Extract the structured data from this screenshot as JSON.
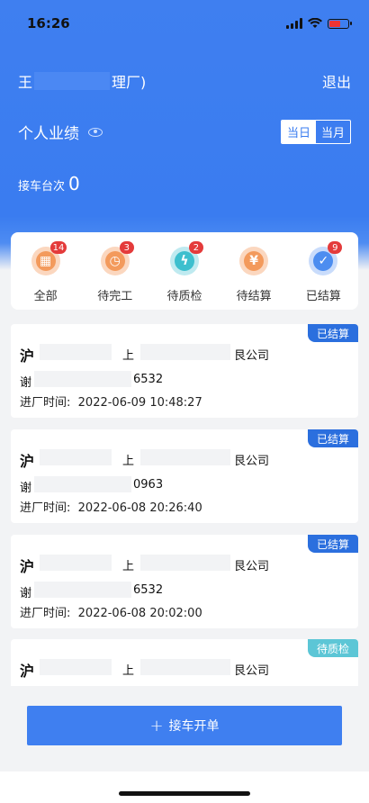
{
  "status": {
    "time": "16:26"
  },
  "header": {
    "user_prefix": "王",
    "user_suffix": "理厂)",
    "logout": "退出",
    "perf_title": "个人业绩",
    "toggle_day": "当日",
    "toggle_month": "当月",
    "count_label": "接车台次",
    "count_value": "0"
  },
  "categories": [
    {
      "label": "全部",
      "badge": "14",
      "color": "#f39a5c",
      "glyph": "▦"
    },
    {
      "label": "待完工",
      "badge": "3",
      "color": "#f39a5c",
      "glyph": "◷"
    },
    {
      "label": "待质检",
      "badge": "2",
      "color": "#3dbfce",
      "glyph": "ϟ"
    },
    {
      "label": "待结算",
      "badge": "",
      "color": "#f39a5c",
      "glyph": "¥"
    },
    {
      "label": "已结算",
      "badge": "9",
      "color": "#4c8df0",
      "glyph": "✓"
    }
  ],
  "cards": [
    {
      "status": "已结算",
      "plate": "沪",
      "company_prefix": "上",
      "company_suffix": "艮公司",
      "owner": "谢",
      "phone_suffix": "6532",
      "time_label": "进厂时间:",
      "time": "2022-06-09 10:48:27"
    },
    {
      "status": "已结算",
      "plate": "沪",
      "company_prefix": "上",
      "company_suffix": "艮公司",
      "owner": "谢",
      "phone_suffix": "0963",
      "time_label": "进厂时间:",
      "time": "2022-06-08 20:26:40"
    },
    {
      "status": "已结算",
      "plate": "沪",
      "company_prefix": "上",
      "company_suffix": "艮公司",
      "owner": "谢",
      "phone_suffix": "6532",
      "time_label": "进厂时间:",
      "time": "2022-06-08 20:02:00"
    },
    {
      "status": "待质检",
      "plate": "沪",
      "company_prefix": "上",
      "company_suffix": "艮公司"
    }
  ],
  "action": {
    "label": "接车开单"
  }
}
